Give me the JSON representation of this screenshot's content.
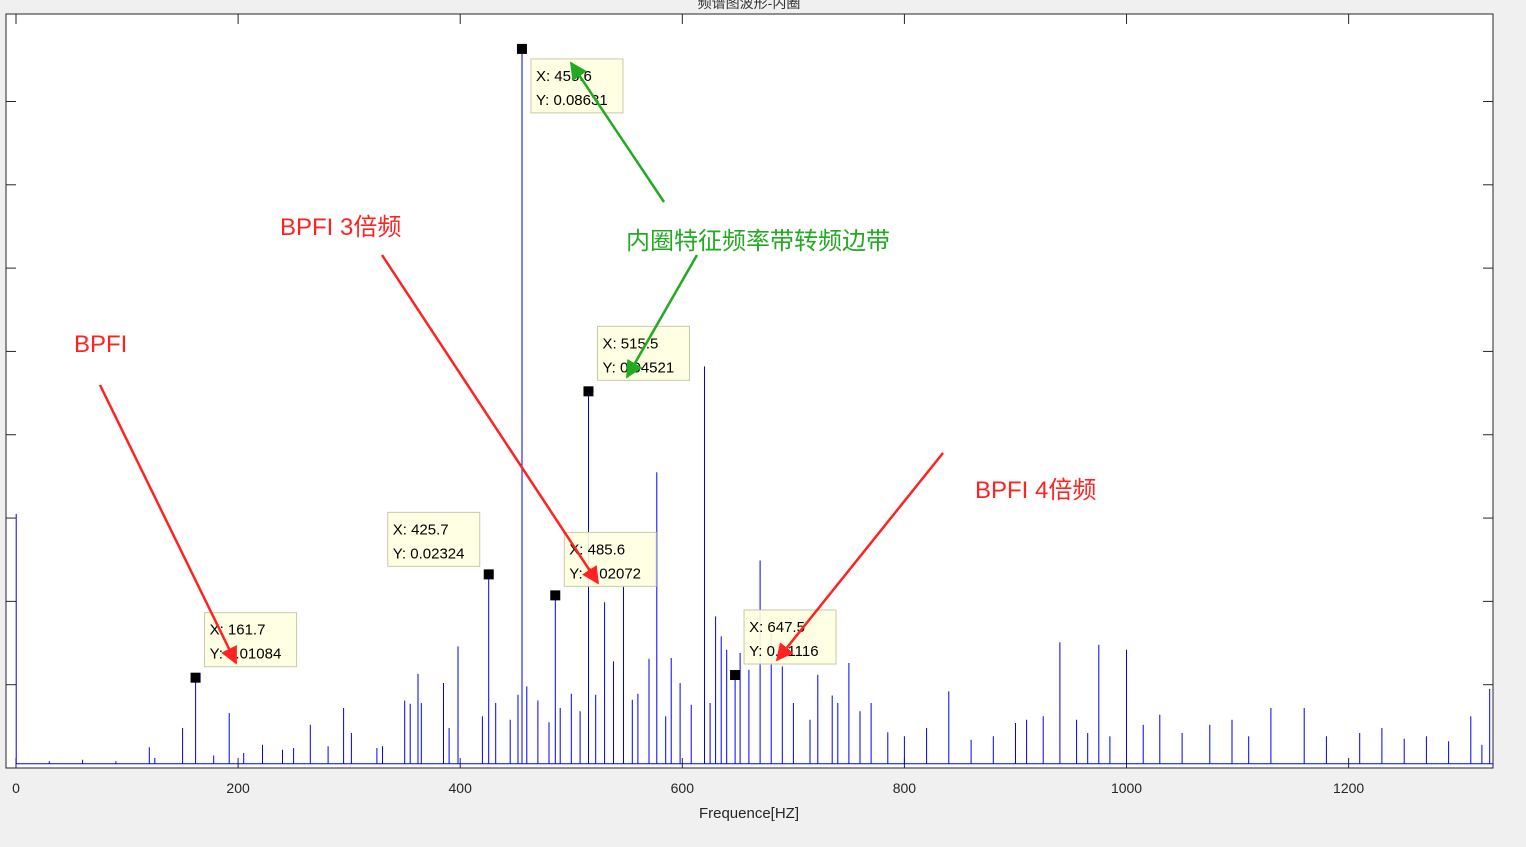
{
  "chart_data": {
    "type": "line",
    "title": "频谱图波形-内圈",
    "xlabel": "Frequence[HZ]",
    "ylabel": "",
    "xlim": [
      -9,
      1330
    ],
    "ylim": [
      0,
      0.0905
    ],
    "xticks": [
      0,
      200,
      400,
      600,
      800,
      1000,
      1200
    ],
    "xtick_labels": [
      "0",
      "200",
      "400",
      "600",
      "800",
      "1000",
      "1200"
    ],
    "yticks": [
      0.01,
      0.02,
      0.03,
      0.04,
      0.05,
      0.06,
      0.07,
      0.08
    ],
    "grid": false,
    "line_color": "#0000ff",
    "baseline": 0.0005,
    "series": [
      {
        "x": [
          0.2,
          30,
          60,
          90,
          120,
          125,
          150,
          161.7,
          178,
          192,
          205,
          222,
          240,
          250,
          265,
          281,
          295,
          302,
          325,
          330,
          350,
          355,
          362,
          365,
          385,
          390,
          398,
          420,
          425.7,
          432,
          445,
          452,
          455.6,
          460,
          470,
          480,
          485.6,
          490,
          500,
          508,
          515.5,
          522,
          530,
          538,
          547,
          555,
          560,
          570,
          577,
          585,
          590,
          598,
          608,
          620,
          625,
          630,
          635,
          640,
          647.5,
          652,
          660,
          670,
          680,
          690,
          700,
          715,
          722,
          735,
          740,
          750,
          760,
          770,
          785,
          800,
          820,
          840,
          860,
          880,
          900,
          910,
          925,
          940,
          955,
          965,
          975,
          985,
          1000,
          1015,
          1030,
          1050,
          1075,
          1095,
          1110,
          1130,
          1160,
          1180,
          1210,
          1230,
          1250,
          1270,
          1290,
          1310,
          1320,
          1327
        ],
        "y": [
          0.0305,
          0.0008,
          0.001,
          0.0008,
          0.0025,
          0.0012,
          0.0048,
          0.01084,
          0.0015,
          0.0066,
          0.0018,
          0.0028,
          0.0022,
          0.0024,
          0.0052,
          0.0026,
          0.0072,
          0.0042,
          0.0024,
          0.0026,
          0.0081,
          0.0077,
          0.0113,
          0.0078,
          0.0102,
          0.0048,
          0.0146,
          0.0062,
          0.02324,
          0.0078,
          0.0058,
          0.0088,
          0.08631,
          0.0098,
          0.0081,
          0.0055,
          0.02072,
          0.0072,
          0.0089,
          0.0068,
          0.04521,
          0.0088,
          0.0199,
          0.0128,
          0.0219,
          0.0082,
          0.0089,
          0.0131,
          0.0355,
          0.0062,
          0.0132,
          0.0102,
          0.0076,
          0.0482,
          0.0078,
          0.0182,
          0.0158,
          0.0142,
          0.01116,
          0.0138,
          0.0118,
          0.0249,
          0.0162,
          0.0122,
          0.0078,
          0.0058,
          0.0112,
          0.0087,
          0.0078,
          0.0126,
          0.0068,
          0.0078,
          0.0043,
          0.0038,
          0.0048,
          0.0092,
          0.0034,
          0.0038,
          0.0054,
          0.0058,
          0.0062,
          0.0151,
          0.0058,
          0.0042,
          0.0148,
          0.0038,
          0.0142,
          0.0052,
          0.0064,
          0.0042,
          0.0052,
          0.0058,
          0.0038,
          0.0072,
          0.0072,
          0.0038,
          0.0042,
          0.0048,
          0.0035,
          0.0038,
          0.0032,
          0.0062,
          0.0028,
          0.0095
        ]
      }
    ],
    "datatips": [
      {
        "x": 161.7,
        "y": 0.01084,
        "x_text": "X: 161.7",
        "y_text": "Y: 0.01084"
      },
      {
        "x": 425.7,
        "y": 0.02324,
        "x_text": "X: 425.7",
        "y_text": "Y: 0.02324"
      },
      {
        "x": 455.6,
        "y": 0.08631,
        "x_text": "X: 455.6",
        "y_text": "Y: 0.08631"
      },
      {
        "x": 485.6,
        "y": 0.02072,
        "x_text": "X: 485.6",
        "y_text": "Y: 0.02072"
      },
      {
        "x": 515.5,
        "y": 0.04521,
        "x_text": "X: 515.5",
        "y_text": "Y: 0.04521"
      },
      {
        "x": 647.5,
        "y": 0.01116,
        "x_text": "X: 647.5",
        "y_text": "Y: 0.01116"
      }
    ],
    "annotations": [
      {
        "text": "BPFI",
        "color": "#ff2222"
      },
      {
        "text": "BPFI 3倍频",
        "color": "#ff2222"
      },
      {
        "text": "内圈特征频率带转频边带",
        "color": "#22aa22"
      },
      {
        "text": "BPFI 4倍频",
        "color": "#ff2222"
      }
    ]
  }
}
